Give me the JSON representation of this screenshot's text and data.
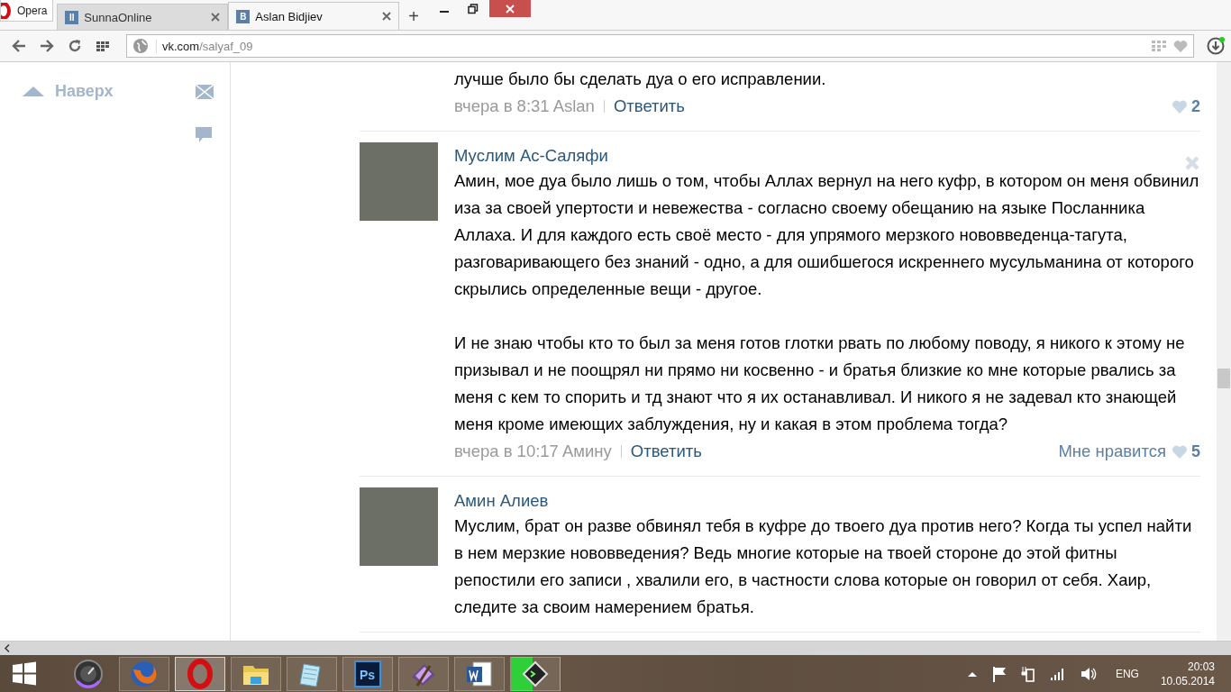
{
  "browser": {
    "menu_label": "Opera",
    "tabs": [
      {
        "title": "SunnaOnline",
        "icon_letter": "II",
        "selected": false
      },
      {
        "title": "Aslan Bidjiev",
        "icon_letter": "B",
        "selected": true
      }
    ],
    "new_tab": "+",
    "address": {
      "host": "vk.com",
      "path": "/salyaf_09"
    }
  },
  "sidebar": {
    "to_top": "Наверх"
  },
  "comments": [
    {
      "partial": true,
      "paragraphs": [
        "лучше было бы сделать дуа о его исправлении."
      ],
      "time": "вчера в 8:31",
      "reply_to": "Aslan",
      "reply": "Ответить",
      "likes": "2",
      "deletable": false
    },
    {
      "partial": false,
      "author": "Муслим Ас-Саляфи",
      "paragraphs": [
        "Амин, мое дуа было лишь о том, чтобы Аллах вернул на него куфр, в котором он меня обвинил иза за своей упертости и невежества - согласно своему обещанию на языке Посланника Аллаха. И для каждого есть своё место - для упрямого мерзкого нововведенца-тагута, разговаривающего без знаний - одно, а для ошибшегося искреннего мусульманина от которого скрылись определенные вещи - другое.",
        "И не знаю чтобы кто то был за меня готов глотки рвать по любому поводу, я никого к этому не призывал и не поощрял ни прямо ни косвенно - и братья близкие ко мне которые рвались за меня с кем то спорить и тд знают что я их останавливал. И никого я не задевал кто знающей меня кроме имеющих заблуждения, ну и какая в этом проблема тогда?"
      ],
      "time": "вчера в 10:17",
      "reply_to": "Амину",
      "reply": "Ответить",
      "like_label": "Мне нравится",
      "likes": "5",
      "deletable": true
    },
    {
      "partial": false,
      "author": "Амин Алиев",
      "paragraphs": [
        "Муслим, брат он разве обвинял тебя в куфре до твоего дуа против него? Когда ты успел найти в нем мерзкие нововведения? Ведь многие которые на твоей стороне до этой фитны репостили его записи , хвалили его, в частности слова которые он говорил от себя. Хаир, следите за своим намерением братья."
      ],
      "deletable": false
    }
  ],
  "taskbar": {
    "photoshop_label": "Ps",
    "language": "ENG",
    "time": "20:03",
    "date": "10.05.2014"
  }
}
